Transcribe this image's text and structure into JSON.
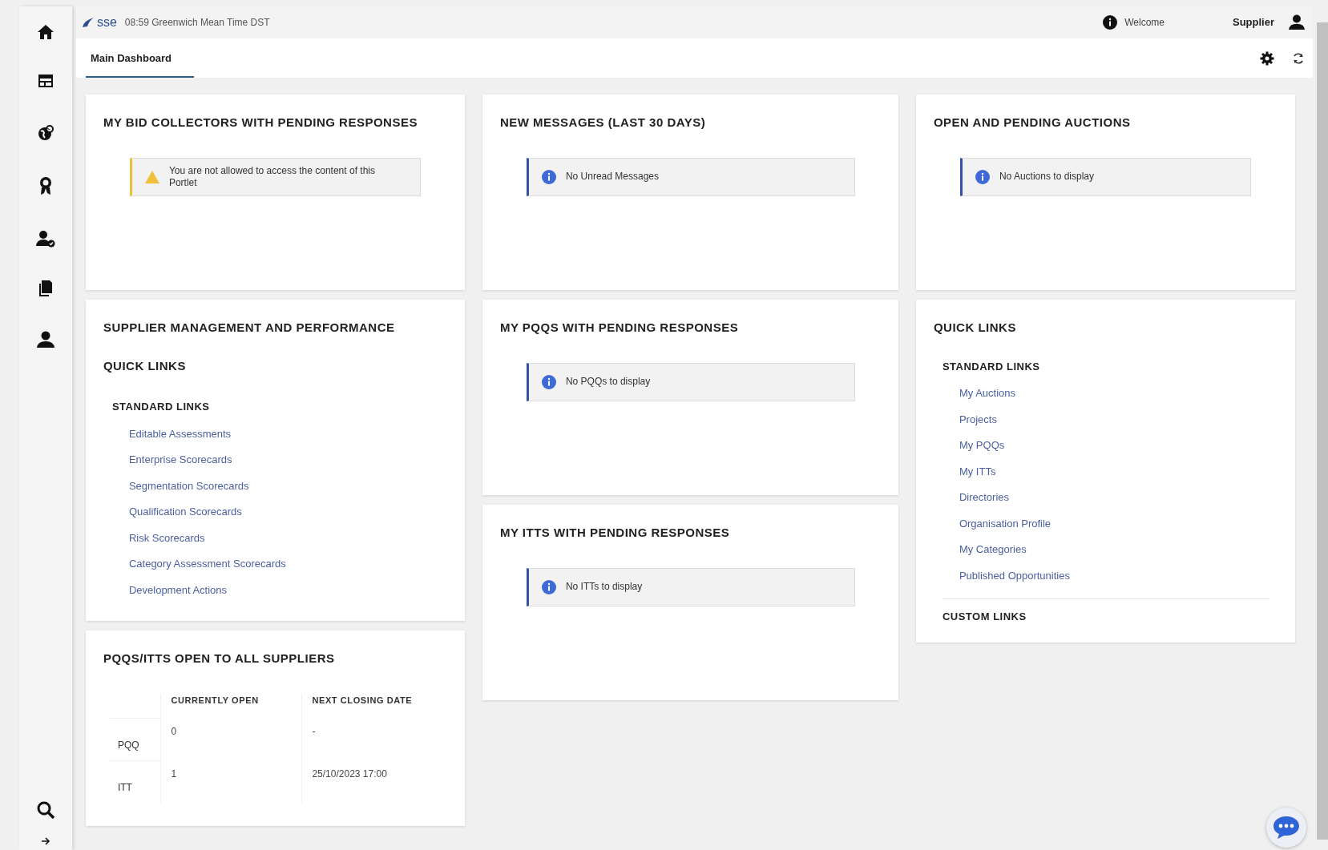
{
  "header": {
    "logo": "sse",
    "time": "08:59 Greenwich Mean Time DST",
    "welcome": "Welcome",
    "user": "Supplier"
  },
  "tabs": [
    {
      "label": "Main Dashboard",
      "selected": true
    }
  ],
  "columns": [
    [
      {
        "kind": "notice",
        "title": "MY BID COLLECTORS WITH PENDING RESPONSES",
        "notice": {
          "kind": "warning",
          "text": "You are not allowed to access the content of this Portlet"
        }
      },
      {
        "kind": "links",
        "title": "SUPPLIER MANAGEMENT AND PERFORMANCE",
        "subtitle": "QUICK LINKS",
        "sections": [
          {
            "heading": "STANDARD LINKS",
            "links": [
              "Editable Assessments",
              "Enterprise Scorecards",
              "Segmentation Scorecards",
              "Qualification Scorecards",
              "Risk Scorecards",
              "Category Assessment Scorecards",
              "Development Actions"
            ]
          }
        ]
      },
      {
        "kind": "table",
        "title": "PQQS/ITTS OPEN TO ALL SUPPLIERS",
        "columns": [
          "CURRENTLY OPEN",
          "NEXT CLOSING DATE"
        ],
        "rows": [
          {
            "label": "PQQ",
            "cells": [
              "0",
              "-"
            ]
          },
          {
            "label": "ITT",
            "cells": [
              "1",
              "25/10/2023 17:00"
            ]
          }
        ]
      }
    ],
    [
      {
        "kind": "notice",
        "title": "NEW MESSAGES (LAST 30 DAYS)",
        "notice": {
          "kind": "info",
          "text": "No Unread Messages"
        }
      },
      {
        "kind": "notice",
        "title": "MY PQQS WITH PENDING RESPONSES",
        "notice": {
          "kind": "info",
          "text": "No PQQs to display"
        }
      },
      {
        "kind": "notice",
        "title": "MY ITTS WITH PENDING RESPONSES",
        "notice": {
          "kind": "info",
          "text": "No ITTs to display"
        }
      }
    ],
    [
      {
        "kind": "notice",
        "title": "OPEN AND PENDING AUCTIONS",
        "notice": {
          "kind": "info",
          "text": "No Auctions to display"
        }
      },
      {
        "kind": "links",
        "title": "QUICK LINKS",
        "sections": [
          {
            "heading": "STANDARD LINKS",
            "links": [
              "My Auctions",
              "Projects",
              "My PQQs",
              "My ITTs",
              "Directories",
              "Organisation Profile",
              "My Categories",
              "Published Opportunities"
            ]
          },
          {
            "heading": "CUSTOM LINKS"
          }
        ]
      }
    ]
  ]
}
